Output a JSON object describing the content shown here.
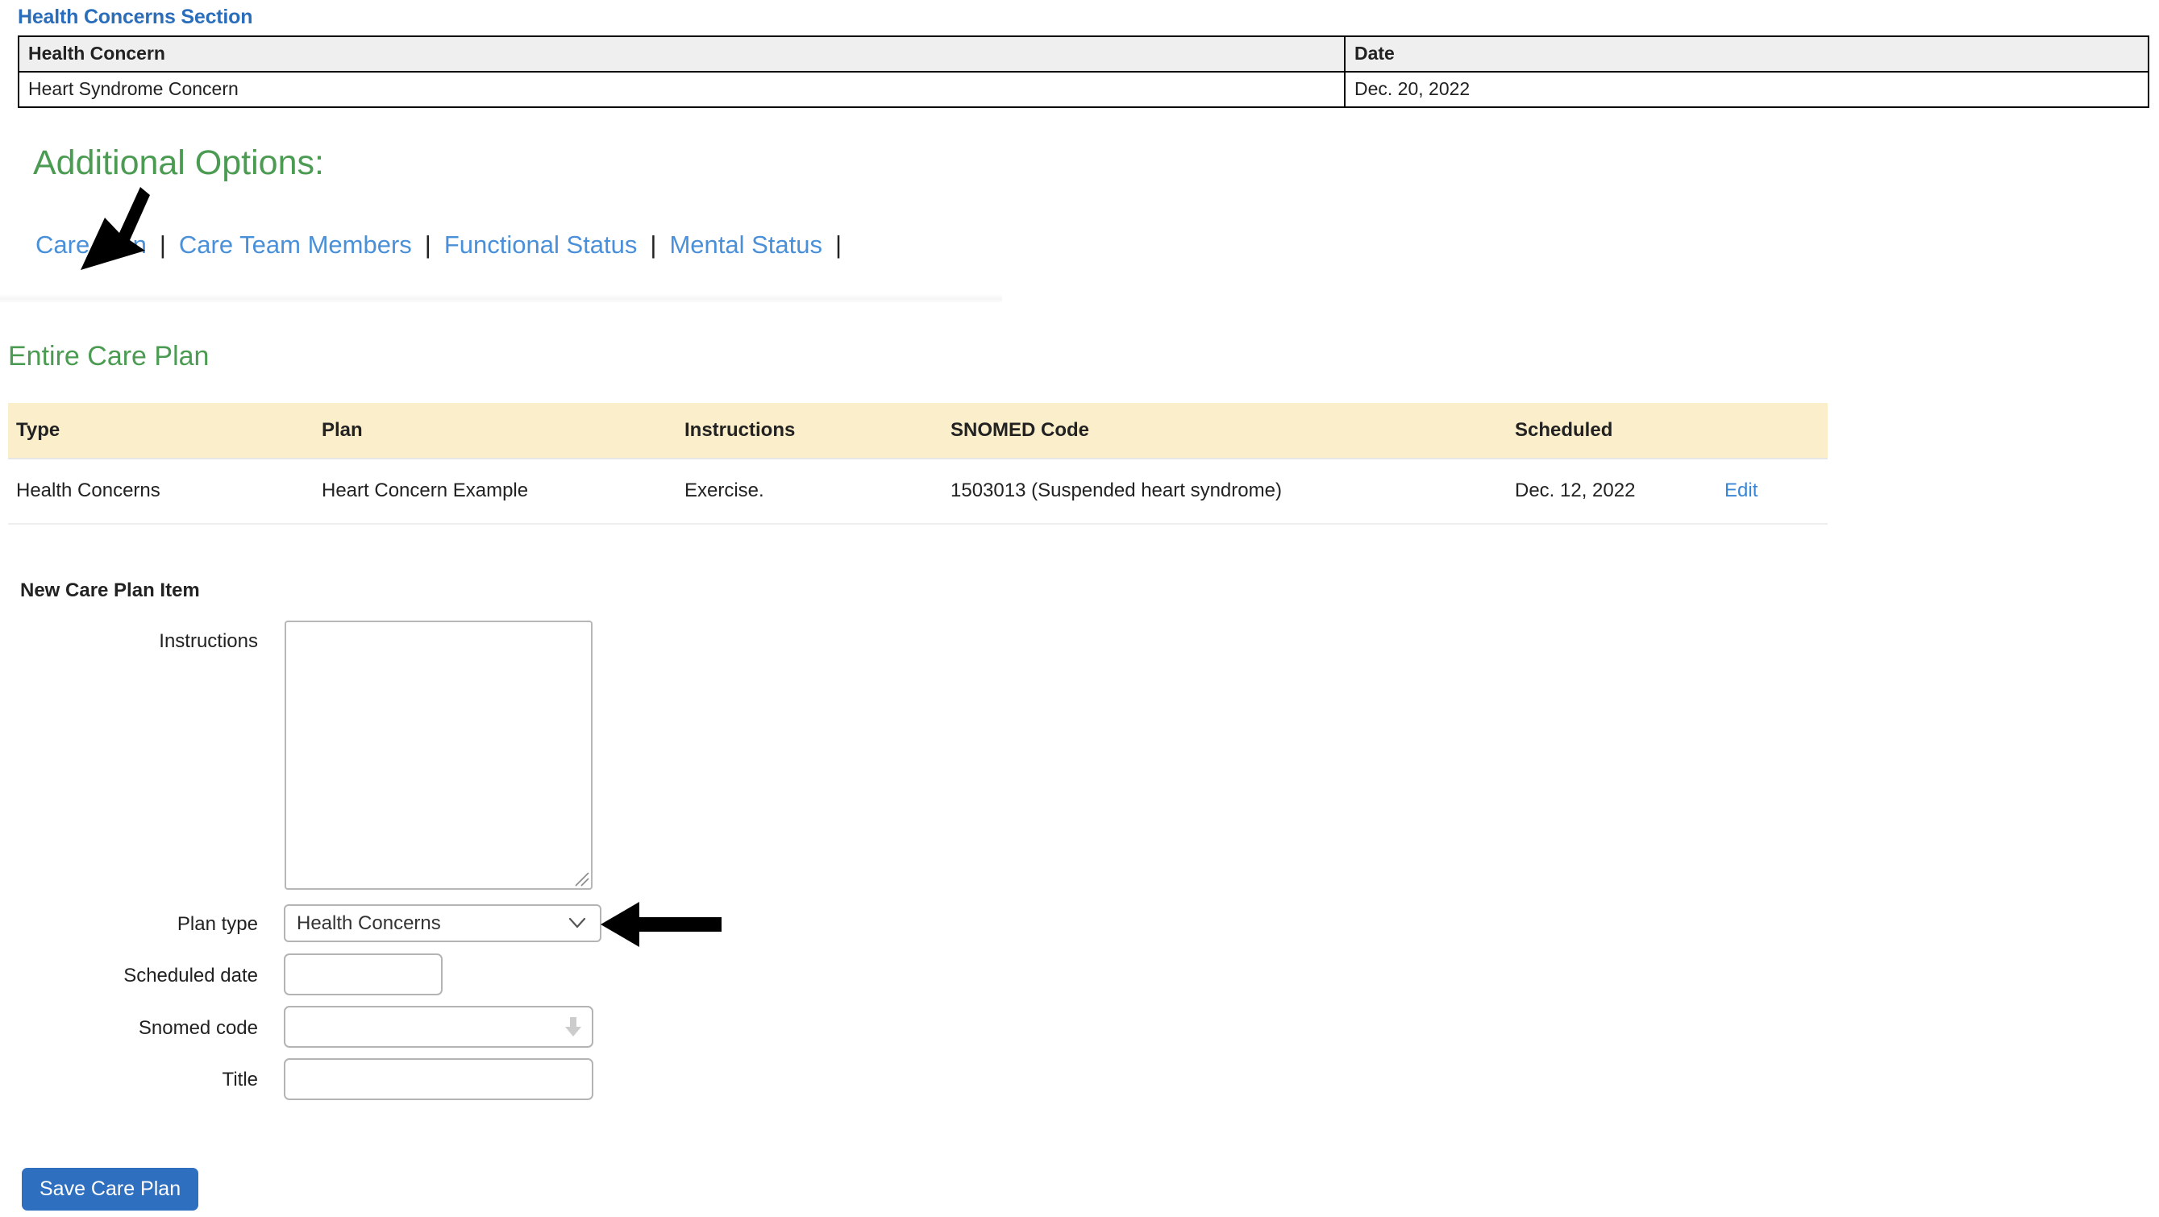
{
  "health_concerns": {
    "section_title": "Health Concerns Section",
    "columns": [
      "Health Concern",
      "Date"
    ],
    "rows": [
      {
        "concern": "Heart Syndrome Concern",
        "date": "Dec. 20, 2022"
      }
    ]
  },
  "additional_options": {
    "heading": "Additional Options:",
    "links": [
      {
        "label": "Care Plan"
      },
      {
        "label": "Care Team Members"
      },
      {
        "label": "Functional Status"
      },
      {
        "label": "Mental Status"
      }
    ],
    "separator": "|"
  },
  "entire_care_plan": {
    "heading": "Entire Care Plan",
    "columns": [
      "Type",
      "Plan",
      "Instructions",
      "SNOMED Code",
      "Scheduled",
      ""
    ],
    "rows": [
      {
        "type": "Health Concerns",
        "plan": "Heart Concern Example",
        "instructions": "Exercise.",
        "snomed_code": "1503013 (Suspended heart syndrome)",
        "scheduled": "Dec. 12, 2022",
        "action": "Edit"
      }
    ]
  },
  "new_care_plan_item": {
    "heading": "New Care Plan Item",
    "fields": {
      "instructions": {
        "label": "Instructions",
        "value": "",
        "placeholder": ""
      },
      "plan_type": {
        "label": "Plan type",
        "value": "Health Concerns",
        "options": [
          "Health Concerns"
        ]
      },
      "scheduled_date": {
        "label": "Scheduled date",
        "value": "",
        "placeholder": ""
      },
      "snomed_code": {
        "label": "Snomed code",
        "value": "",
        "placeholder": ""
      },
      "title": {
        "label": "Title",
        "value": "",
        "placeholder": ""
      }
    },
    "save_button": "Save Care Plan"
  },
  "annotations": {
    "arrow_care_plan": "arrow pointing to Care Plan link",
    "arrow_plan_type": "arrow pointing to Plan type dropdown"
  },
  "colors": {
    "section_title_blue": "#2a6ebb",
    "heading_green": "#4b9b52",
    "link_blue": "#4a90d9",
    "table_header_cream": "#fbeecb",
    "table_header_gray": "#efefef",
    "button_blue": "#2f6fc0"
  }
}
